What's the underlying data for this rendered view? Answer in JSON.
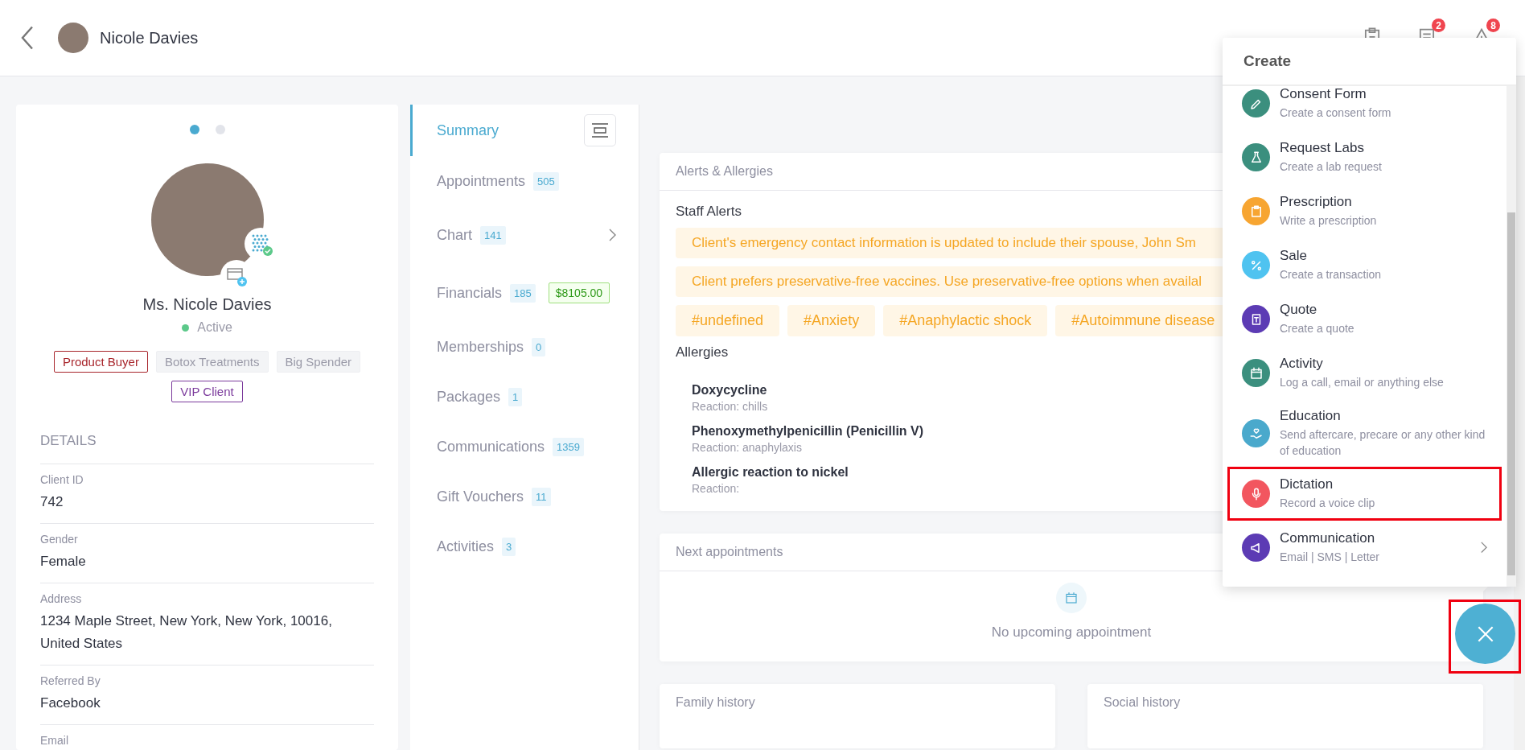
{
  "header": {
    "client_name": "Nicole Davies",
    "badges": [
      {
        "kind": "clipboard"
      },
      {
        "kind": "document",
        "count": "2"
      },
      {
        "kind": "warning",
        "count": "8"
      }
    ]
  },
  "profile": {
    "pages": [
      {
        "selected": true
      },
      {
        "selected": false
      }
    ],
    "name": "Ms. Nicole Davies",
    "status": "Active",
    "active": true,
    "tags": [
      {
        "label": "Product Buyer",
        "color": "#a8262c",
        "outlined": true
      },
      {
        "label": "Botox Treatments",
        "color": "#9a9aa8",
        "outlined": false
      },
      {
        "label": "Big Spender",
        "color": "#9a9aa8",
        "outlined": false
      },
      {
        "label": "VIP Client",
        "color": "#7b3a9c",
        "outlined": true
      }
    ],
    "details_title": "DETAILS",
    "details": [
      {
        "label": "Client ID",
        "value": "742"
      },
      {
        "label": "Gender",
        "value": "Female"
      },
      {
        "label": "Address",
        "value": "1234 Maple Street, New York, New York, 10016, United States"
      },
      {
        "label": "Referred By",
        "value": "Facebook"
      },
      {
        "label": "Email"
      }
    ]
  },
  "tabs": [
    {
      "label": "Summary",
      "selected": true
    },
    {
      "label": "Appointments",
      "count": "505",
      "selected": false
    },
    {
      "label": "Chart",
      "count": "141",
      "selected": false,
      "has_submenu": true
    },
    {
      "label": "Financials",
      "count": "185",
      "amount": "$8105.00",
      "selected": false
    },
    {
      "label": "Memberships",
      "count": "0",
      "selected": false
    },
    {
      "label": "Packages",
      "count": "1",
      "selected": false
    },
    {
      "label": "Communications",
      "count": "1359",
      "selected": false
    },
    {
      "label": "Gift Vouchers",
      "count": "11",
      "selected": false
    },
    {
      "label": "Activities",
      "count": "3",
      "selected": false
    }
  ],
  "alerts_card": {
    "title": "Alerts & Allergies",
    "staff_alerts_title": "Staff Alerts",
    "alerts": [
      "Client's emergency contact information is updated to include their spouse, John Sm",
      "Client prefers preservative-free vaccines. Use preservative-free options when availal"
    ],
    "hashtags": [
      "#undefined",
      "#Anxiety",
      "#Anaphylactic shock",
      "#Autoimmune disease"
    ],
    "allergies_title": "Allergies",
    "allergies": [
      {
        "name": "Doxycycline",
        "reaction": "Reaction: chills"
      },
      {
        "name": "Phenoxymethylpenicillin (Penicillin V)",
        "reaction": "Reaction: anaphylaxis"
      },
      {
        "name": "Allergic reaction to nickel",
        "reaction": "Reaction:"
      }
    ]
  },
  "next_appointments": {
    "title": "Next appointments",
    "empty_text": "No upcoming appointment"
  },
  "bottom_cards": [
    {
      "title": "Family history"
    },
    {
      "title": "Social history"
    }
  ],
  "create_menu": {
    "title": "Create",
    "items": [
      {
        "kind": "pen",
        "title": "Consent Form",
        "subtitle": "Create a consent form",
        "color": "#3b8f7e",
        "highlighted": false
      },
      {
        "kind": "flask",
        "title": "Request Labs",
        "subtitle": "Create a lab request",
        "color": "#3b8f7e",
        "highlighted": false
      },
      {
        "kind": "clipboard",
        "title": "Prescription",
        "subtitle": "Write a prescription",
        "color": "#f7a531",
        "highlighted": false
      },
      {
        "kind": "percent",
        "title": "Sale",
        "subtitle": "Create a transaction",
        "color": "#4fc3f0",
        "highlighted": false
      },
      {
        "kind": "quote",
        "title": "Quote",
        "subtitle": "Create a quote",
        "color": "#5c3bb4",
        "highlighted": false
      },
      {
        "kind": "calendar",
        "title": "Activity",
        "subtitle": "Log a call, email or anything else",
        "color": "#3b8f7e",
        "highlighted": false
      },
      {
        "kind": "heart-hand",
        "title": "Education",
        "subtitle": "Send aftercare, precare or any other kind of education",
        "color": "#4aa9cc",
        "highlighted": false
      },
      {
        "kind": "mic",
        "title": "Dictation",
        "subtitle": "Record a voice clip",
        "color": "#f2565f",
        "highlighted": true
      },
      {
        "kind": "megaphone",
        "title": "Communication",
        "subtitle": "Email | SMS | Letter",
        "color": "#5c3bb4",
        "highlighted": false,
        "has_submenu": true
      }
    ]
  },
  "fab": {
    "open": true,
    "highlighted": true
  }
}
